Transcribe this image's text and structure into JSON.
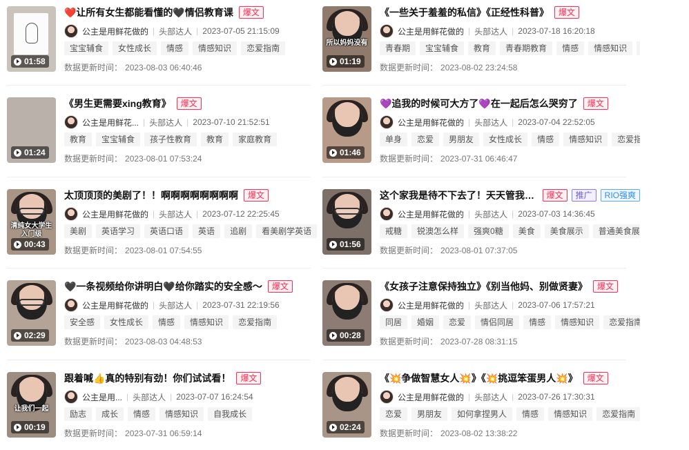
{
  "labels": {
    "update_prefix": "数据更新时间："
  },
  "colors": {
    "hot_badge": "#fe2c55",
    "ad_badge": "#6e5bd9",
    "brand_badge": "#2e8de8",
    "tag_bg": "#f4f4f4"
  },
  "videos": [
    {
      "title": "❤️让所有女生都能看懂的🖤情侣教育课",
      "badges": [
        "爆文"
      ],
      "author": "公主是用鲜花做的",
      "level": "头部达人",
      "publish_time": "2023-07-05 21:15:09",
      "tags": [
        "宝宝辅食",
        "女性成长",
        "情感",
        "情感知识",
        "恋爱指南"
      ],
      "update_time": "2023-08-03 06:40:46",
      "duration": "01:58",
      "thumb": {
        "style": "sketch",
        "bg": "#c9c3bb",
        "caption": ""
      }
    },
    {
      "title": "《一些关于羞羞的私信》《正经性科普》",
      "badges": [
        "爆文"
      ],
      "author": "公主是用鲜花做的",
      "level": "头部达人",
      "publish_time": "2023-07-18 16:20:18",
      "tags": [
        "青春期",
        "宝宝辅食",
        "教育",
        "青春期教育",
        "情感",
        "情感知识",
        "恋爱指南"
      ],
      "update_time": "2023-08-02 23:24:58",
      "duration": "01:19",
      "thumb": {
        "style": "face",
        "bg": "#8f7a6c",
        "caption": "所以妈妈没有"
      }
    },
    {
      "title": "《男生更需要xing教育》",
      "badges": [
        "爆文"
      ],
      "author": "公主是用鲜花...",
      "level": "头部达人",
      "publish_time": "2023-07-10 21:52:51",
      "tags": [
        "教育",
        "宝宝辅食",
        "孩子性教育",
        "教育",
        "家庭教育"
      ],
      "update_time": "2023-08-01 07:53:24",
      "duration": "01:24",
      "thumb": {
        "style": "plain",
        "bg": "#b9b1aa",
        "caption": ""
      }
    },
    {
      "title": "💜追我的时候可大方了💜在一起后怎么哭穷了",
      "badges": [
        "爆文"
      ],
      "author": "公主是用鲜花做的",
      "level": "头部达人",
      "publish_time": "2023-07-04 22:52:05",
      "tags": [
        "单身",
        "恋爱",
        "男朋友",
        "女性成长",
        "情感",
        "情感知识",
        "恋爱指南"
      ],
      "update_time": "2023-07-31 06:46:47",
      "duration": "01:46",
      "thumb": {
        "style": "face",
        "bg": "#b89a88",
        "caption": ""
      }
    },
    {
      "title": "太顶顶顶的美剧了！！啊啊啊啊啊啊啊啊",
      "badges": [
        "爆文"
      ],
      "author": "公主是用鲜花做的",
      "level": "头部达人",
      "publish_time": "2023-07-12 22:25:45",
      "tags": [
        "美剧",
        "英语学习",
        "英语口语",
        "英语",
        "追剧",
        "看美剧学英语"
      ],
      "update_time": "2023-08-01 07:54:55",
      "duration": "00:43",
      "thumb": {
        "style": "glasses",
        "bg": "#a89586",
        "caption": "清纯女大学生入门级"
      }
    },
    {
      "title": "这个家我是待不下去了！天天管我！天天管我！",
      "badges": [
        "爆文",
        "推广",
        "RIO强爽"
      ],
      "author": "公主是用鲜花做的",
      "level": "头部达人",
      "publish_time": "2023-07-03 14:36:45",
      "tags": [
        "戒糖",
        "锐澳怎么样",
        "强爽0糖",
        "美食",
        "美食展示",
        "普通美食展示"
      ],
      "update_time": "2023-08-01 07:37:05",
      "duration": "01:56",
      "thumb": {
        "style": "glasses",
        "bg": "#7d7068",
        "caption": ""
      }
    },
    {
      "title": "🖤一条视频给你讲明白🖤给你踏实的安全感～",
      "badges": [
        "爆文"
      ],
      "author": "公主是用鲜花做的",
      "level": "头部达人",
      "publish_time": "2023-07-31 22:19:56",
      "tags": [
        "安全感",
        "女性成长",
        "情感",
        "情感知识",
        "恋爱指南"
      ],
      "update_time": "2023-08-03 04:48:53",
      "duration": "02:29",
      "thumb": {
        "style": "glasses",
        "bg": "#b4a397",
        "caption": ""
      }
    },
    {
      "title": "《女孩子注意保持独立》《别当他妈、别做贤妻》",
      "badges": [
        "爆文"
      ],
      "author": "公主是用鲜花做的",
      "level": "头部达人",
      "publish_time": "2023-07-06 17:57:21",
      "tags": [
        "同居",
        "婚姻",
        "恋爱",
        "情侣同居",
        "情感",
        "情感知识",
        "恋爱指南"
      ],
      "update_time": "2023-07-28 08:31:15",
      "duration": "00:28",
      "thumb": {
        "style": "face",
        "bg": "#8c7c74",
        "caption": ""
      }
    },
    {
      "title": "跟着喊👍真的特别有劲！你们试试看！",
      "badges": [
        "爆文"
      ],
      "author": "公主是用...",
      "level": "头部达人",
      "publish_time": "2023-07-07 16:24:54",
      "tags": [
        "励志",
        "成长",
        "情感",
        "情感知识",
        "自我成长"
      ],
      "update_time": "2023-07-31 06:59:14",
      "duration": "00:19",
      "thumb": {
        "style": "face",
        "bg": "#9d8d80",
        "caption": "让我们一起"
      }
    },
    {
      "title": "《💥争做智慧女人💥》《💥挑逗笨蛋男人💥》",
      "badges": [
        "爆文"
      ],
      "author": "公主是用鲜花做的",
      "level": "头部达人",
      "publish_time": "2023-07-26 17:30:31",
      "tags": [
        "恋爱",
        "男朋友",
        "如何拿捏男人",
        "情感",
        "情感知识",
        "恋爱指南"
      ],
      "update_time": "2023-08-02 13:38:22",
      "duration": "02:24",
      "thumb": {
        "style": "face",
        "bg": "#a99488",
        "caption": ""
      }
    }
  ]
}
